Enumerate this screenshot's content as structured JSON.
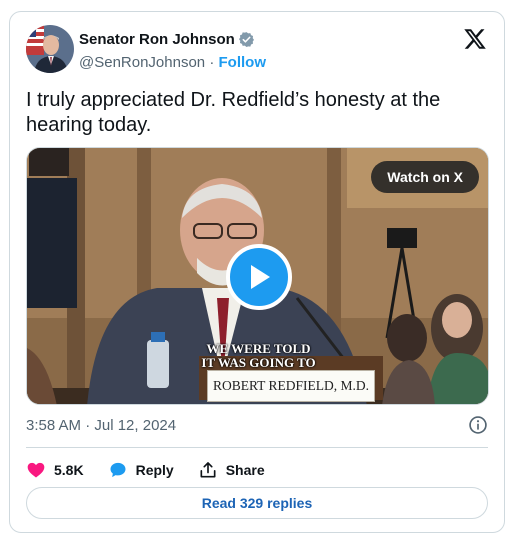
{
  "author": {
    "name": "Senator Ron Johnson",
    "handle": "@SenRonJohnson",
    "separator": "·",
    "follow_label": "Follow"
  },
  "tweet": {
    "text": "I truly appreciated Dr. Redfield’s honesty at the hearing today.",
    "timestamp": "3:58 AM · Jul 12, 2024"
  },
  "video": {
    "watch_label": "Watch on X",
    "caption_line1": "WE WERE TOLD",
    "caption_line2": "IT WAS GOING TO",
    "nameplate": "ROBERT REDFIELD, M.D."
  },
  "actions": {
    "like_count": "5.8K",
    "reply_label": "Reply",
    "share_label": "Share"
  },
  "footer": {
    "read_replies_label": "Read 329 replies"
  },
  "colors": {
    "accent": "#1d9bf0",
    "like": "#f91880",
    "text_secondary": "#536471",
    "border": "#cfd9de"
  },
  "icons": [
    "verified-badge-icon",
    "x-logo-icon",
    "play-icon",
    "info-icon",
    "heart-icon",
    "reply-bubble-icon",
    "share-icon"
  ]
}
